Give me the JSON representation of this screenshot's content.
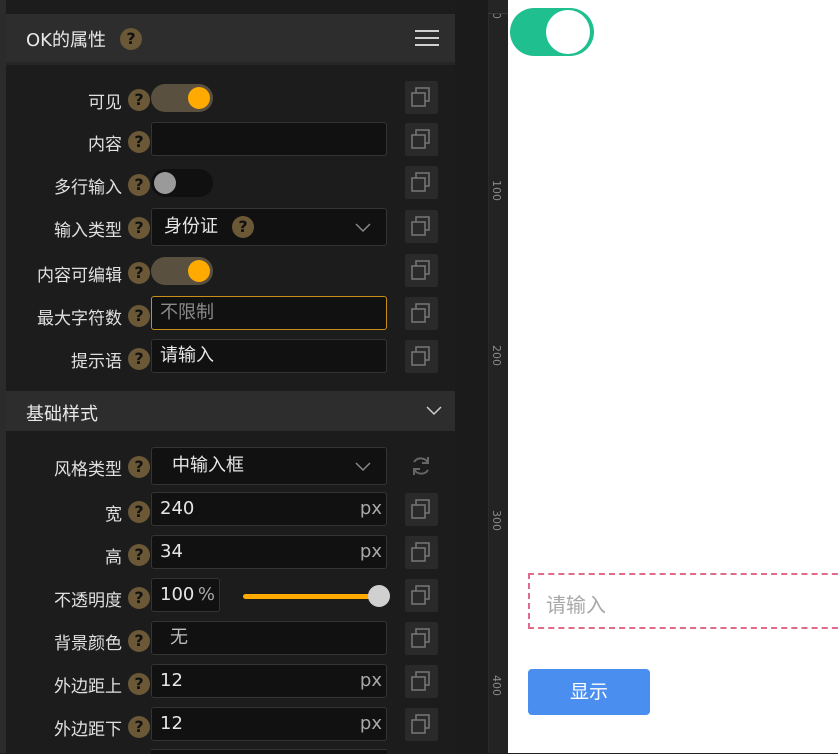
{
  "panel": {
    "title": "OK的属性",
    "section2_title": "基础样式"
  },
  "props": {
    "visible": {
      "label": "可见",
      "on": true
    },
    "content": {
      "label": "内容",
      "value": ""
    },
    "multiline": {
      "label": "多行输入",
      "on": false
    },
    "input_type": {
      "label": "输入类型",
      "value": "身份证"
    },
    "editable": {
      "label": "内容可编辑",
      "on": true
    },
    "max_chars": {
      "label": "最大字符数",
      "placeholder": "不限制"
    },
    "hint": {
      "label": "提示语",
      "value": "请输入"
    }
  },
  "style": {
    "style_type": {
      "label": "风格类型",
      "value": "中输入框"
    },
    "width": {
      "label": "宽",
      "value": "240",
      "unit": "px"
    },
    "height": {
      "label": "高",
      "value": "34",
      "unit": "px"
    },
    "opacity": {
      "label": "不透明度",
      "value": "100",
      "unit": "%",
      "level": 1.0
    },
    "bg_color": {
      "label": "背景颜色",
      "value": "无"
    },
    "margin_top": {
      "label": "外边距上",
      "value": "12",
      "unit": "px"
    },
    "margin_bottom": {
      "label": "外边距下",
      "value": "12",
      "unit": "px"
    }
  },
  "ruler": {
    "ticks": [
      "0",
      "100",
      "200",
      "300",
      "400"
    ]
  },
  "preview": {
    "input_placeholder": "请输入",
    "button_label": "显示",
    "toggle_on": true
  },
  "colors": {
    "accent": "#ffaa00",
    "toggle_track_on": "#5a5040",
    "preview_toggle": "#1fbf8f",
    "button": "#4a8ef0"
  }
}
